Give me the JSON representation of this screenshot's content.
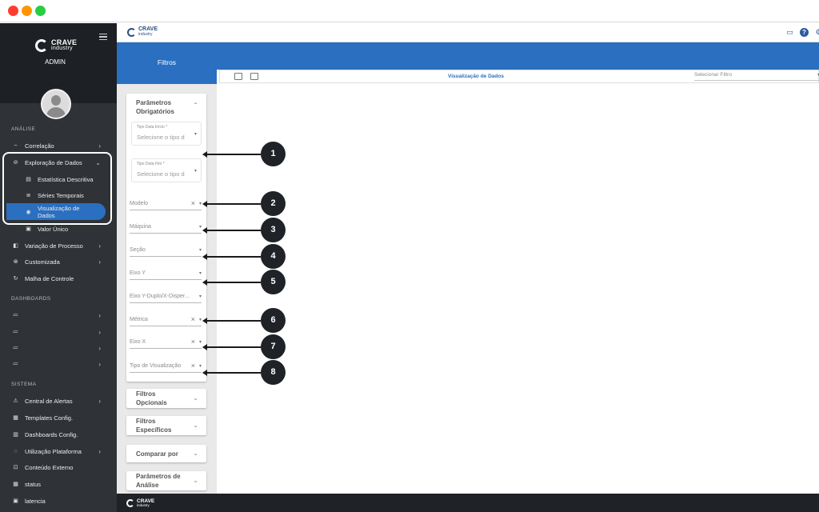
{
  "brand": {
    "name": "CRAVE",
    "sub": "industry",
    "role": "ADMIN"
  },
  "sidebar": {
    "section_analise": "ANÁLISE",
    "section_dashboards": "DASHBOARDS",
    "section_sistema": "SISTEMA",
    "items": [
      {
        "label": "Correlação",
        "icon": "~"
      },
      {
        "label": "Exploração de Dados",
        "icon": "⊘"
      },
      {
        "label": "Estatística Descritiva",
        "icon": "▤"
      },
      {
        "label": "Séries Temporais",
        "icon": "≣"
      },
      {
        "label": "Visualização de Dados",
        "icon": "◉"
      },
      {
        "label": "Valor Único",
        "icon": "▣"
      },
      {
        "label": "Variação de Processo",
        "icon": "◧"
      },
      {
        "label": "Customizada",
        "icon": "⊗"
      },
      {
        "label": "Malha de Controle",
        "icon": "↻"
      }
    ],
    "dashboards": [
      "",
      "",
      "",
      ""
    ],
    "sistema": [
      {
        "label": "Central de Alertas",
        "icon": "⚠"
      },
      {
        "label": "Templates Config.",
        "icon": "▦"
      },
      {
        "label": "Dashboards Config.",
        "icon": "▥"
      },
      {
        "label": "Utilização Plataforma",
        "icon": "◌"
      },
      {
        "label": "Conteúdo Externo",
        "icon": "⊡"
      },
      {
        "label": "status",
        "icon": "▦"
      },
      {
        "label": "latencia",
        "icon": "▣"
      }
    ]
  },
  "tabs": {
    "filtros": "Filtros"
  },
  "filters": {
    "required_title_1": "Parâmetros",
    "required_title_2": "Obrigatórios",
    "tipo_data_inicio_label": "Tipo Data Início *",
    "tipo_data_inicio_placeholder": "Selecione o tipo d",
    "tipo_data_fim_label": "Tipo Data Fim *",
    "tipo_data_fim_placeholder": "Selecione o tipo d",
    "fields": [
      "Modelo",
      "Máquina",
      "Seção",
      "Eixo Y",
      "Eixo Y-Duplo/X-Disper...",
      "Métrica",
      "Eixo X",
      "Tipo de Visualização"
    ],
    "opcionais_1": "Filtros",
    "opcionais_2": "Opcionais",
    "especificos_1": "Filtros",
    "especificos_2": "Específicos",
    "comparar": "Comparar por",
    "analise_1": "Parâmetros de",
    "analise_2": "Análise"
  },
  "content": {
    "title": "Visualização de Dados",
    "select_placeholder": "Selecionar Filtro"
  },
  "annotations": [
    "1",
    "2",
    "3",
    "4",
    "5",
    "6",
    "7",
    "8"
  ]
}
